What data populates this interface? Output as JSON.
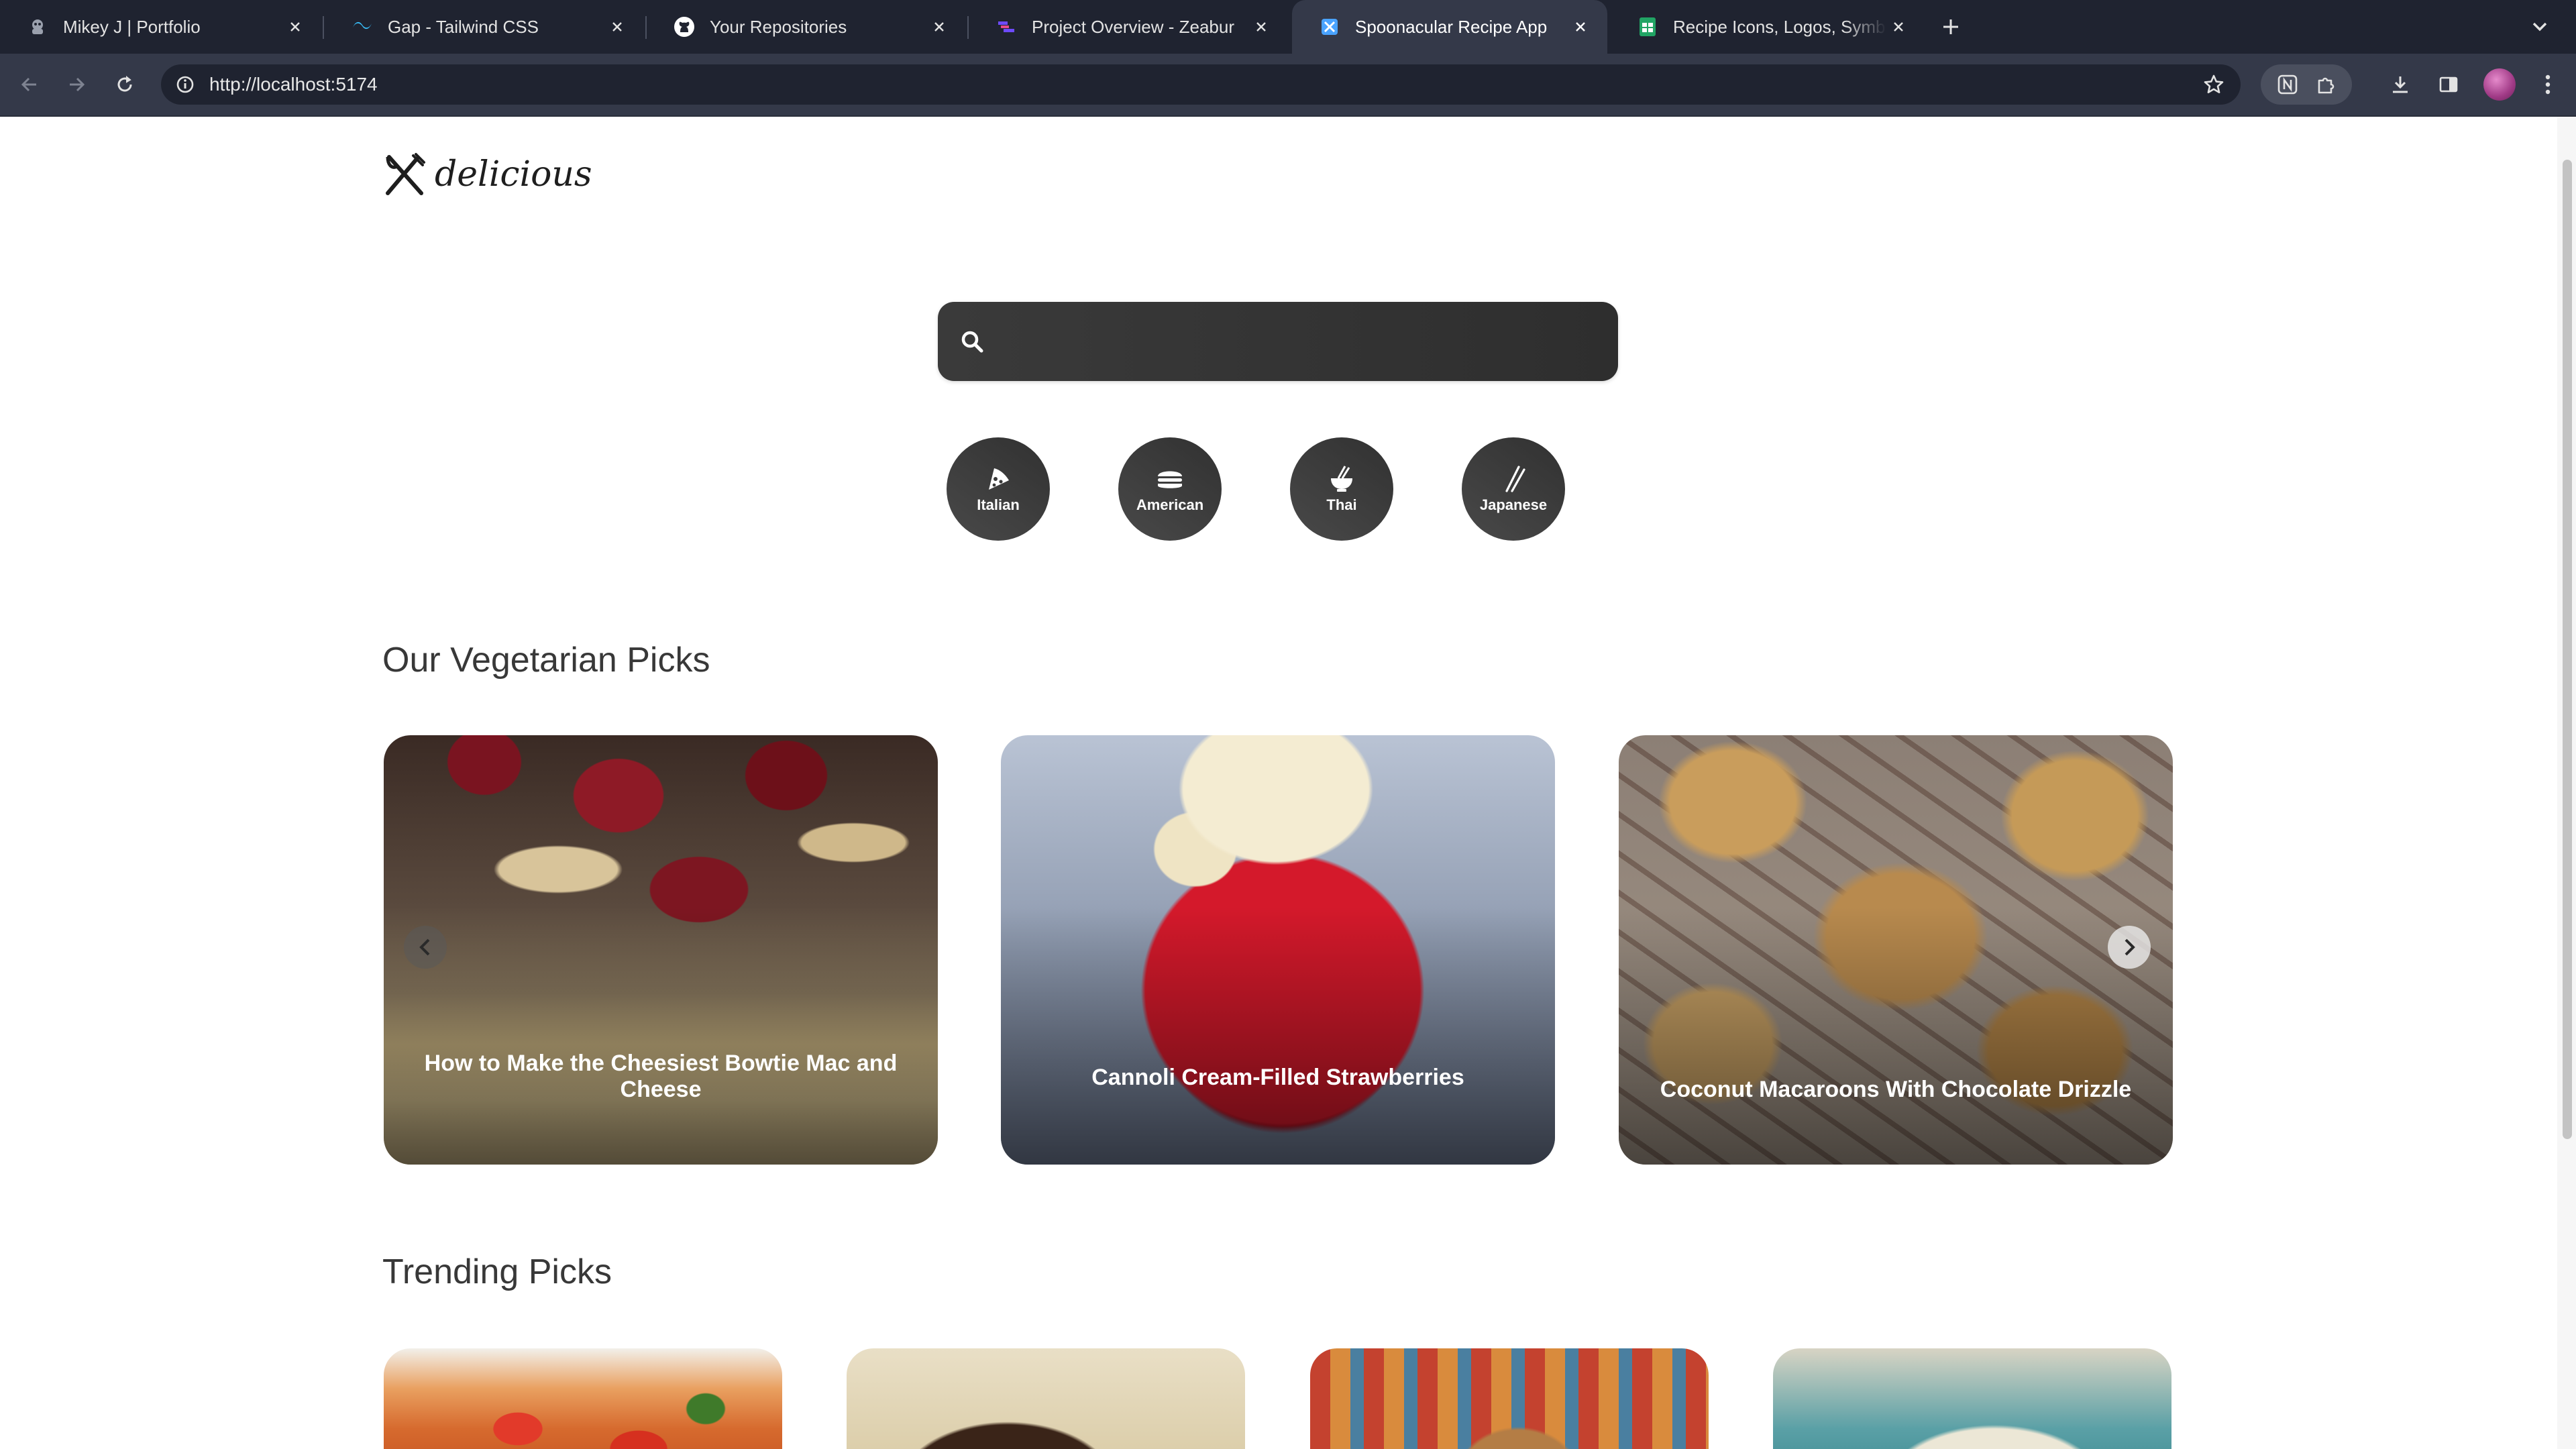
{
  "browser": {
    "tabs": [
      {
        "title": "Mikey J | Portfolio",
        "icon": "portfolio-icon",
        "active": false
      },
      {
        "title": "Gap - Tailwind CSS",
        "icon": "tailwind-icon",
        "active": false
      },
      {
        "title": "Your Repositories",
        "icon": "github-icon",
        "active": false
      },
      {
        "title": "Project Overview - Zeabur",
        "icon": "zeabur-icon",
        "active": false
      },
      {
        "title": "Spoonacular Recipe App",
        "icon": "app-icon",
        "active": true
      },
      {
        "title": "Recipe Icons, Logos, Symbols",
        "icon": "sheets-icon",
        "active": false
      }
    ],
    "url": "http://localhost:5174"
  },
  "page": {
    "logo_text": "delicious",
    "search": {
      "value": ""
    },
    "cuisines": [
      {
        "label": "Italian",
        "icon": "pizza-icon"
      },
      {
        "label": "American",
        "icon": "burger-icon"
      },
      {
        "label": "Thai",
        "icon": "noodle-bowl-icon"
      },
      {
        "label": "Japanese",
        "icon": "chopsticks-icon"
      }
    ],
    "veggie": {
      "title": "Our Vegetarian Picks",
      "cards": [
        {
          "title": "How to Make the Cheesiest Bowtie Mac and Cheese"
        },
        {
          "title": "Cannoli Cream-Filled Strawberries"
        },
        {
          "title": "Coconut Macaroons With Chocolate Drizzle"
        }
      ]
    },
    "trending": {
      "title": "Trending Picks"
    }
  },
  "colors": {
    "chrome_dark": "#1f2330",
    "chrome_tab_active": "#343949",
    "button_dark": "#313131",
    "heading": "#383838"
  }
}
